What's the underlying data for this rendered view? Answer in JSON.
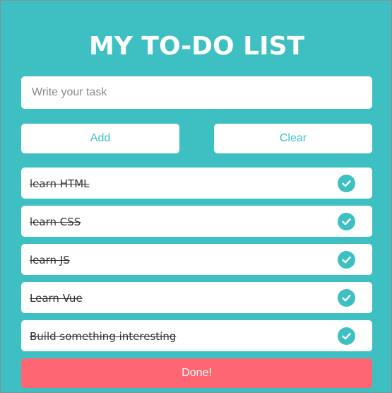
{
  "header": {
    "title": "MY TO-DO LIST"
  },
  "input": {
    "placeholder": "Write your task",
    "value": ""
  },
  "buttons": {
    "add_label": "Add",
    "clear_label": "Clear",
    "done_label": "Done!"
  },
  "tasks": [
    {
      "text": "learn HTML",
      "completed": true,
      "icon": "check-circle-icon"
    },
    {
      "text": "learn CSS",
      "completed": true,
      "icon": "check-circle-icon"
    },
    {
      "text": "learn JS",
      "completed": true,
      "icon": "check-circle-icon"
    },
    {
      "text": "Learn Vue",
      "completed": true,
      "icon": "check-circle-icon"
    },
    {
      "text": "Build something interesting",
      "completed": true,
      "icon": "check-circle-icon"
    }
  ],
  "colors": {
    "background": "#3ec0c3",
    "accent": "#3ec0c3",
    "done_button": "#ff6673",
    "card": "#ffffff"
  }
}
